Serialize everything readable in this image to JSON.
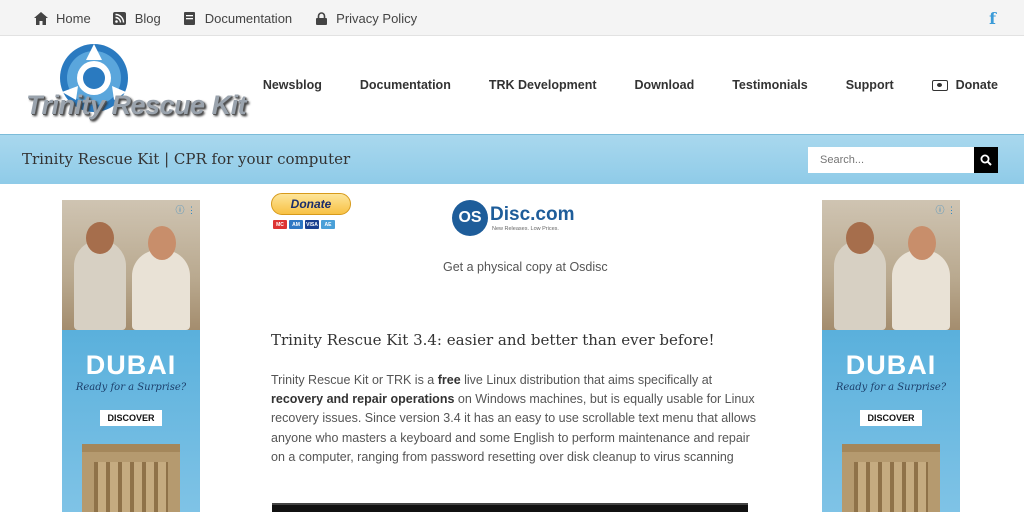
{
  "topbar": {
    "items": [
      {
        "label": "Home",
        "icon": "home-icon"
      },
      {
        "label": "Blog",
        "icon": "rss-icon"
      },
      {
        "label": "Documentation",
        "icon": "book-icon"
      },
      {
        "label": "Privacy Policy",
        "icon": "lock-icon"
      }
    ],
    "social": {
      "label": "f",
      "icon": "facebook-icon"
    }
  },
  "header": {
    "logo_text": "Trinity Rescue Kit",
    "nav": [
      "Newsblog",
      "Documentation",
      "TRK Development",
      "Download",
      "Testimonials",
      "Support",
      "Donate"
    ]
  },
  "banner": {
    "tagline": "Trinity Rescue Kit | CPR for your computer",
    "search_placeholder": "Search..."
  },
  "ads": {
    "headline": "DUBAI",
    "subline": "Ready for a Surprise?",
    "cta": "DISCOVER"
  },
  "donate_box": {
    "button": "Donate",
    "cards": [
      "MC",
      "AM",
      "VISA",
      "AE"
    ]
  },
  "osdisc": {
    "mark": "OS",
    "name": "Disc.com",
    "tagline": "New Releases. Low Prices.",
    "caption": "Get a physical copy at Osdisc"
  },
  "article": {
    "title": "Trinity Rescue Kit 3.4: easier and better than ever before!",
    "p_1": "Trinity Rescue Kit or TRK is a ",
    "p_free": "free",
    "p_2": " live Linux distribution that aims specifically at ",
    "p_bold": "recovery and repair operations",
    "p_3": " on Windows machines, but is equally usable for Linux recovery issues. Since version 3.4 it has an easy to use scrollable text menu that allows anyone who masters a keyboard and some English to perform maintenance and repair on a computer, ranging from password resetting over disk cleanup to virus scanning"
  },
  "colors": {
    "banner": "#8fcbe8",
    "facebook": "#3b9bd8",
    "osdisc": "#1e5d9a"
  }
}
